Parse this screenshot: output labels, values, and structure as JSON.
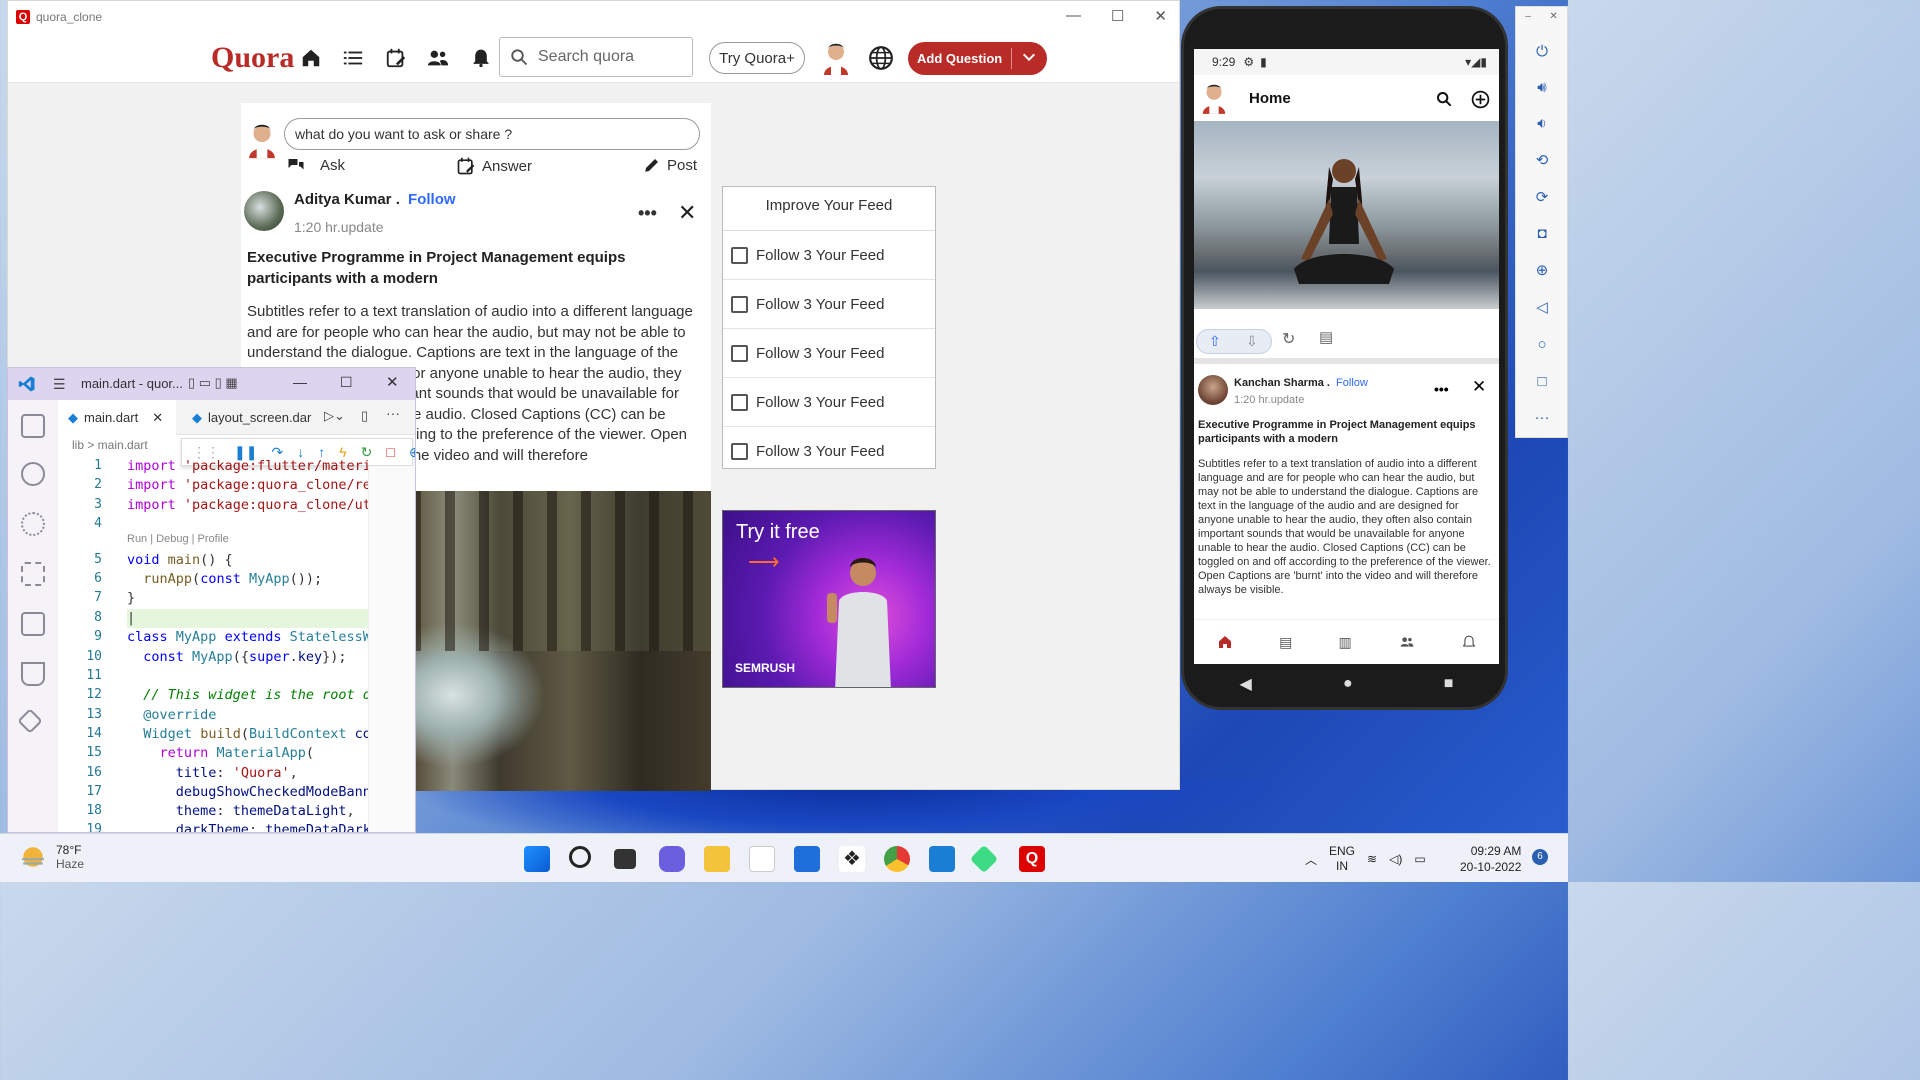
{
  "quora_window": {
    "title": "quora_clone",
    "logo_char": "Q",
    "brand": "Quora",
    "search_placeholder": "Search quora",
    "try_button": "Try Quora+",
    "add_question": "Add Question",
    "ask_placeholder": "what do you want to ask or share ?",
    "actions": {
      "ask": "Ask",
      "answer": "Answer",
      "post": "Post"
    },
    "post": {
      "author": "Aditya Kumar .",
      "follow": "Follow",
      "time": "1:20 hr.update",
      "headline": "Executive Programme in Project Management equips participants with a modern",
      "body": "Subtitles refer to a text translation of audio into a different language and are for people who can hear the audio, but may not be able to understand the dialogue. Captions are text in the language of the audio and are designed for anyone unable to hear the audio, they often also contain important sounds that would be unavailable for anyone unable to hear the audio. Closed Captions (CC) can be toggled on and off according to the preference of the viewer. Open Captions are 'burnt' into the video and will therefore"
    },
    "feed": {
      "title": "Improve Your Feed",
      "items": [
        "Follow 3 Your Feed",
        "Follow 3 Your Feed",
        "Follow 3 Your Feed",
        "Follow 3 Your Feed",
        "Follow 3 Your Feed"
      ]
    },
    "ad": {
      "text": "Try it free",
      "arrow": "⟶",
      "brand": "SEMRUSH"
    }
  },
  "vscode": {
    "title": "main.dart - quor...",
    "tabs": [
      "main.dart",
      "layout_screen.dar"
    ],
    "breadcrumb": "lib  >  main.dart",
    "code_lens": "Run | Debug | Profile",
    "line_numbers": [
      "1",
      "2",
      "3",
      "4",
      "5",
      "6",
      "7",
      "8",
      "9",
      "10",
      "11",
      "12",
      "13",
      "14",
      "15",
      "16",
      "17",
      "18",
      "19"
    ]
  },
  "phone": {
    "time": "9:29",
    "app_title": "Home",
    "post": {
      "author": "Kanchan Sharma .",
      "follow": "Follow",
      "time": "1:20 hr.update",
      "headline": "Executive Programme in Project Management equips participants with a modern",
      "body": "Subtitles refer to a text translation of audio into a different language and are for people who can hear the audio, but may not be able to understand the dialogue. Captions are text in the language of the audio and are designed for anyone unable to hear the audio, they often also contain important sounds that would be unavailable for anyone unable to hear the audio. Closed Captions (CC) can be toggled on and off according to the preference of the viewer. Open Captions are 'burnt' into the video and will therefore always be visible."
    }
  },
  "taskbar": {
    "temperature": "78°F",
    "condition": "Haze",
    "language": "ENG",
    "region": "IN",
    "time": "09:29 AM",
    "date": "20-10-2022",
    "notifications": "6"
  },
  "colors": {
    "quora_red": "#b92b27",
    "follow_blue": "#2e69ff",
    "accent": "#2b5fb3"
  }
}
